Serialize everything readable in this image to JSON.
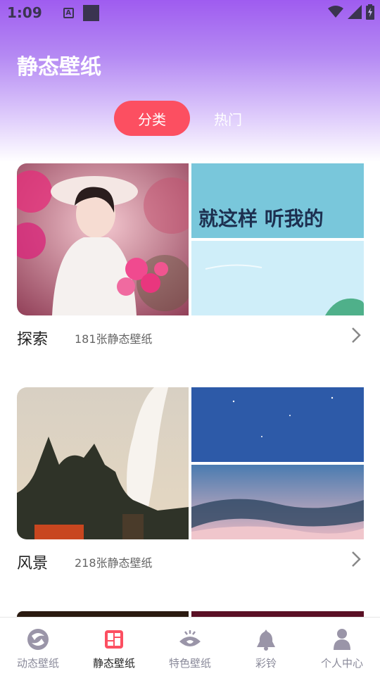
{
  "status_bar": {
    "time": "1:09",
    "a_icon": "A"
  },
  "header": {
    "title": "静态壁纸"
  },
  "tabs": [
    {
      "label": "分类",
      "active": true
    },
    {
      "label": "热门",
      "active": false
    }
  ],
  "sections": [
    {
      "name": "探索",
      "count": "181张静态壁纸",
      "banner_text": "就这样 听我的"
    },
    {
      "name": "风景",
      "count": "218张静态壁纸"
    }
  ],
  "bottom_nav": [
    {
      "label": "动态壁纸",
      "icon": "dynamic-wallpaper-icon",
      "active": false
    },
    {
      "label": "静态壁纸",
      "icon": "static-wallpaper-icon",
      "active": true
    },
    {
      "label": "特色壁纸",
      "icon": "eye-crown-icon",
      "active": false
    },
    {
      "label": "彩铃",
      "icon": "bell-icon",
      "active": false
    },
    {
      "label": "个人中心",
      "icon": "person-icon",
      "active": false
    }
  ],
  "colors": {
    "accent": "#fc4f61",
    "gradient_top": "#9f5cf0",
    "icon_gray": "#9a95a8"
  }
}
